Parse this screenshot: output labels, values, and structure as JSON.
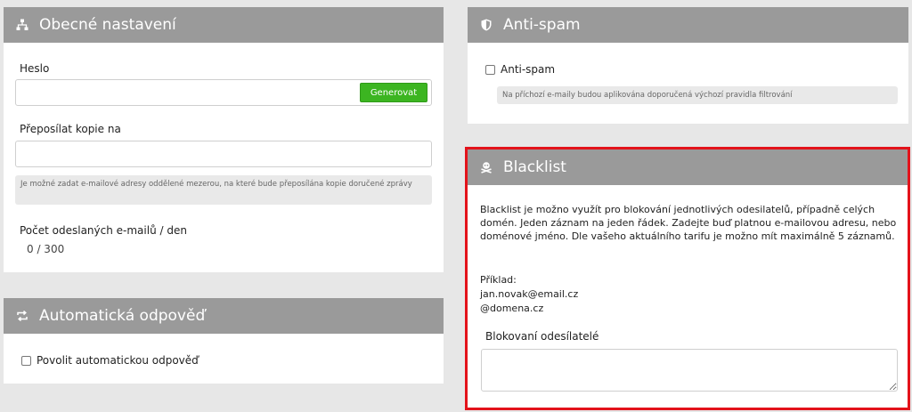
{
  "general": {
    "title": "Obecné nastavení",
    "password_label": "Heslo",
    "password_value": "",
    "generate_button": "Generovat",
    "forward_label": "Přeposílat kopie na",
    "forward_value": "",
    "forward_hint": "Je možné zadat e-mailové adresy oddělené mezerou, na které bude přeposílána kopie doručené zprávy",
    "sent_count_label": "Počet odeslaných e-mailů / den",
    "sent_count_value": "0 / 300"
  },
  "autoreply": {
    "title": "Automatická odpověď",
    "enable_label": "Povolit automatickou odpověď",
    "enabled": false
  },
  "antispam": {
    "title": "Anti-spam",
    "checkbox_label": "Anti-spam",
    "enabled": false,
    "hint": "Na příchozí e-maily budou aplikována doporučená výchozí pravidla filtrování"
  },
  "blacklist": {
    "title": "Blacklist",
    "description": "Blacklist je možno využít pro blokování jednotlivých odesilatelů, případně celých domén. Jeden záznam na jeden řádek. Zadejte buď platnou e-mailovou adresu, nebo doménové jméno. Dle vašeho aktuálního tarifu je možno mít maximálně 5 záznamů.",
    "example_label": "Příklad:",
    "example_email": "jan.novak@email.cz",
    "example_domain": "@domena.cz",
    "blocked_label": "Blokovaní odesílatelé",
    "blocked_value": ""
  },
  "colors": {
    "header_bg": "#9a9a9a",
    "button_green": "#3cb521",
    "highlight_red": "#e3131b"
  },
  "icons": {
    "general": "sitemap-icon",
    "autoreply": "retweet-icon",
    "antispam": "shield-icon",
    "blacklist": "skull-crossbones-icon"
  }
}
